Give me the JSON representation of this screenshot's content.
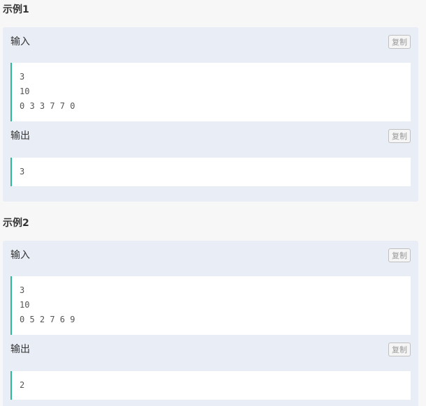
{
  "examples": [
    {
      "title": "示例1",
      "input_label": "输入",
      "output_label": "输出",
      "copy_label": "复制",
      "input_lines": [
        "3",
        "10",
        "0 3 3 7 7 0"
      ],
      "output_lines": [
        "3"
      ]
    },
    {
      "title": "示例2",
      "input_label": "输入",
      "output_label": "输出",
      "copy_label": "复制",
      "input_lines": [
        "3",
        "10",
        "0 5 2 7 6 9"
      ],
      "output_lines": [
        "2"
      ]
    }
  ],
  "colors": {
    "panel_bg": "#e9eef6",
    "code_border": "#25bb9b",
    "page_bg": "#f7f7f7"
  }
}
